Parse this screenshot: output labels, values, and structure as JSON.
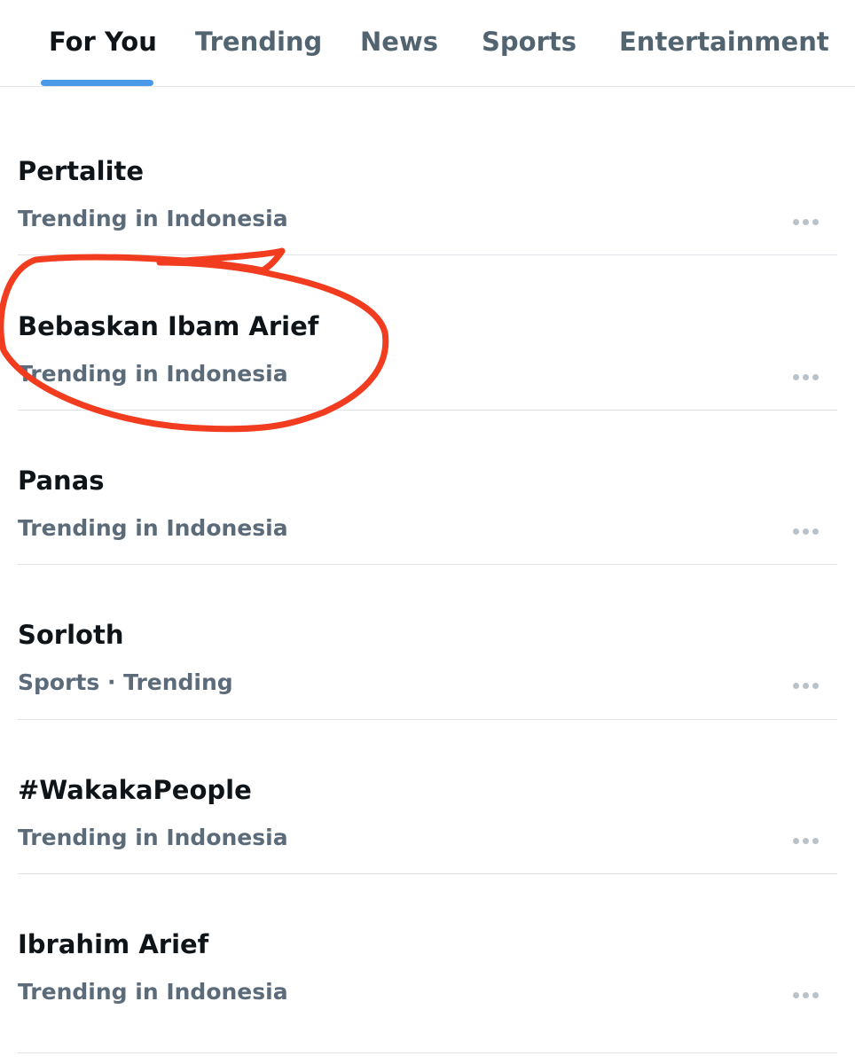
{
  "tabs": [
    {
      "label": "For You",
      "active": true
    },
    {
      "label": "Trending",
      "active": false
    },
    {
      "label": "News",
      "active": false
    },
    {
      "label": "Sports",
      "active": false
    },
    {
      "label": "Entertainment",
      "active": false
    }
  ],
  "trends": [
    {
      "topic": "Pertalite",
      "meta": "Trending in Indonesia"
    },
    {
      "topic": "Bebaskan Ibam Arief",
      "meta": "Trending in Indonesia"
    },
    {
      "topic": "Panas",
      "meta": "Trending in Indonesia"
    },
    {
      "topic": "Sorloth",
      "meta": "Sports · Trending"
    },
    {
      "topic": "#WakakaPeople",
      "meta": "Trending in Indonesia"
    },
    {
      "topic": "Ibrahim Arief",
      "meta": "Trending in Indonesia"
    }
  ],
  "icons": {
    "more": "more-horizontal-icon"
  },
  "colors": {
    "accent": "#4a99e9",
    "text_primary": "#0f1419",
    "text_secondary": "#5c6b79",
    "annotation": "#f23c1f"
  }
}
